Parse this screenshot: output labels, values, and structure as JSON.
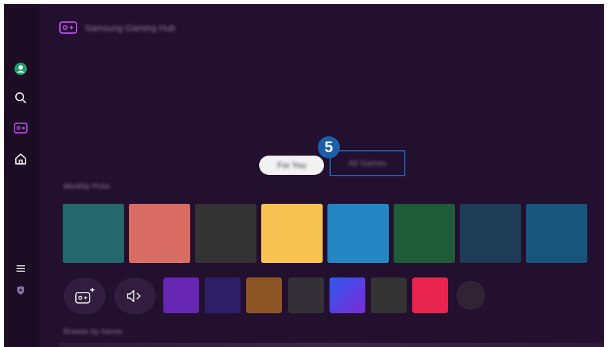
{
  "header": {
    "app_title": "Samsung Gaming Hub"
  },
  "sidebar": {
    "items": [
      {
        "name": "profile",
        "icon": "profile-icon"
      },
      {
        "name": "search",
        "icon": "search-icon"
      },
      {
        "name": "gaming-hub",
        "icon": "gamepad-icon"
      },
      {
        "name": "home",
        "icon": "home-icon"
      },
      {
        "name": "menu",
        "icon": "hamburger-menu-icon"
      },
      {
        "name": "privacy",
        "icon": "shield-icon"
      }
    ]
  },
  "tabs": [
    {
      "label": "For You",
      "selected": true
    },
    {
      "label": "All Games",
      "selected": false,
      "highlighted": true
    }
  ],
  "callout": {
    "number": "5"
  },
  "sections": {
    "monthly_picks": "Monthly Picks",
    "browse_by_genre": "Browse by Genre"
  },
  "tile_colors": [
    "#25686b",
    "#d96c65",
    "#333333",
    "#f7c352",
    "#2486c2",
    "#1f5b38",
    "#1e3c55",
    "#17557d"
  ],
  "small_tile_colors": [
    "#6826b5",
    "#2c1f68",
    "#8e5525",
    "#333037",
    "#5b35e6",
    "#333333",
    "#e8244f"
  ],
  "buttons": {
    "add_controller": {
      "icon": "gamepad-plus-icon"
    },
    "sound_output": {
      "icon": "speaker-icon"
    }
  },
  "colors": {
    "background": "#230f2e",
    "sidebar": "#1c0c24",
    "accent": "#9c3fe0",
    "highlight_border": "#1c5ea8"
  }
}
